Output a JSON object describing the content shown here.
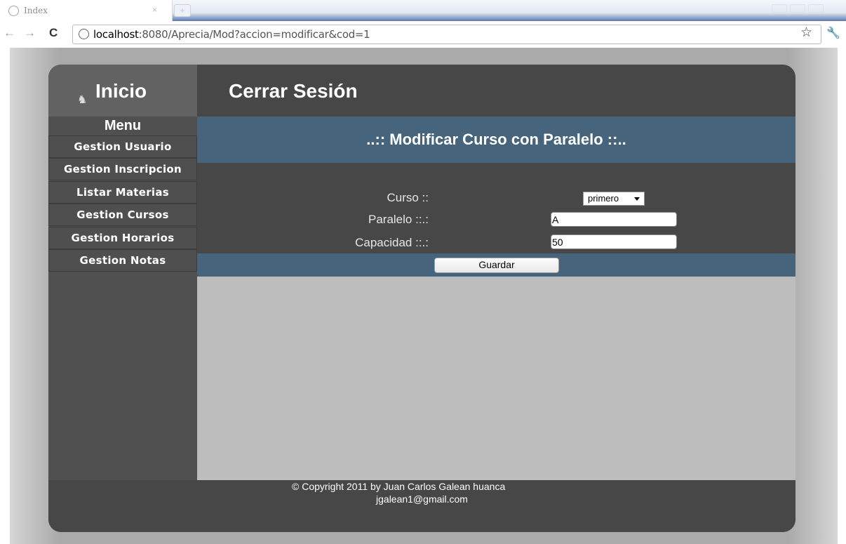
{
  "browser": {
    "tab_title": "Index",
    "tab_close": "×",
    "url_host": "localhost",
    "url_rest": ":8080/Aprecia/Mod?accion=modificar&cod=1"
  },
  "header": {
    "inicio_label": "Inicio",
    "cerrar_sesion_label": "Cerrar Sesión"
  },
  "sidebar": {
    "menu_title": "Menu",
    "items": [
      {
        "label": "Gestion Usuario"
      },
      {
        "label": "Gestion Inscripcion"
      },
      {
        "label": "Listar Materias"
      },
      {
        "label": "Gestion Cursos"
      },
      {
        "label": "Gestion Horarios"
      },
      {
        "label": "Gestion Notas"
      }
    ]
  },
  "main": {
    "heading": "..:: Modificar Curso con Paralelo ::..",
    "form": {
      "curso_label": "Curso ::",
      "curso_value": "primero",
      "paralelo_label": "Paralelo ::.:",
      "paralelo_value": "A",
      "capacidad_label": "Capacidad ::.:",
      "capacidad_value": "50",
      "submit_label": "Guardar"
    }
  },
  "footer": {
    "copyright": "© Copyright 2011 by Juan Carlos Galean huanca",
    "email": "jgalean1@gmail.com"
  },
  "colors": {
    "band_blue": "#46647c",
    "dark_panel": "#474747",
    "content_gray": "#bdbdbd"
  }
}
